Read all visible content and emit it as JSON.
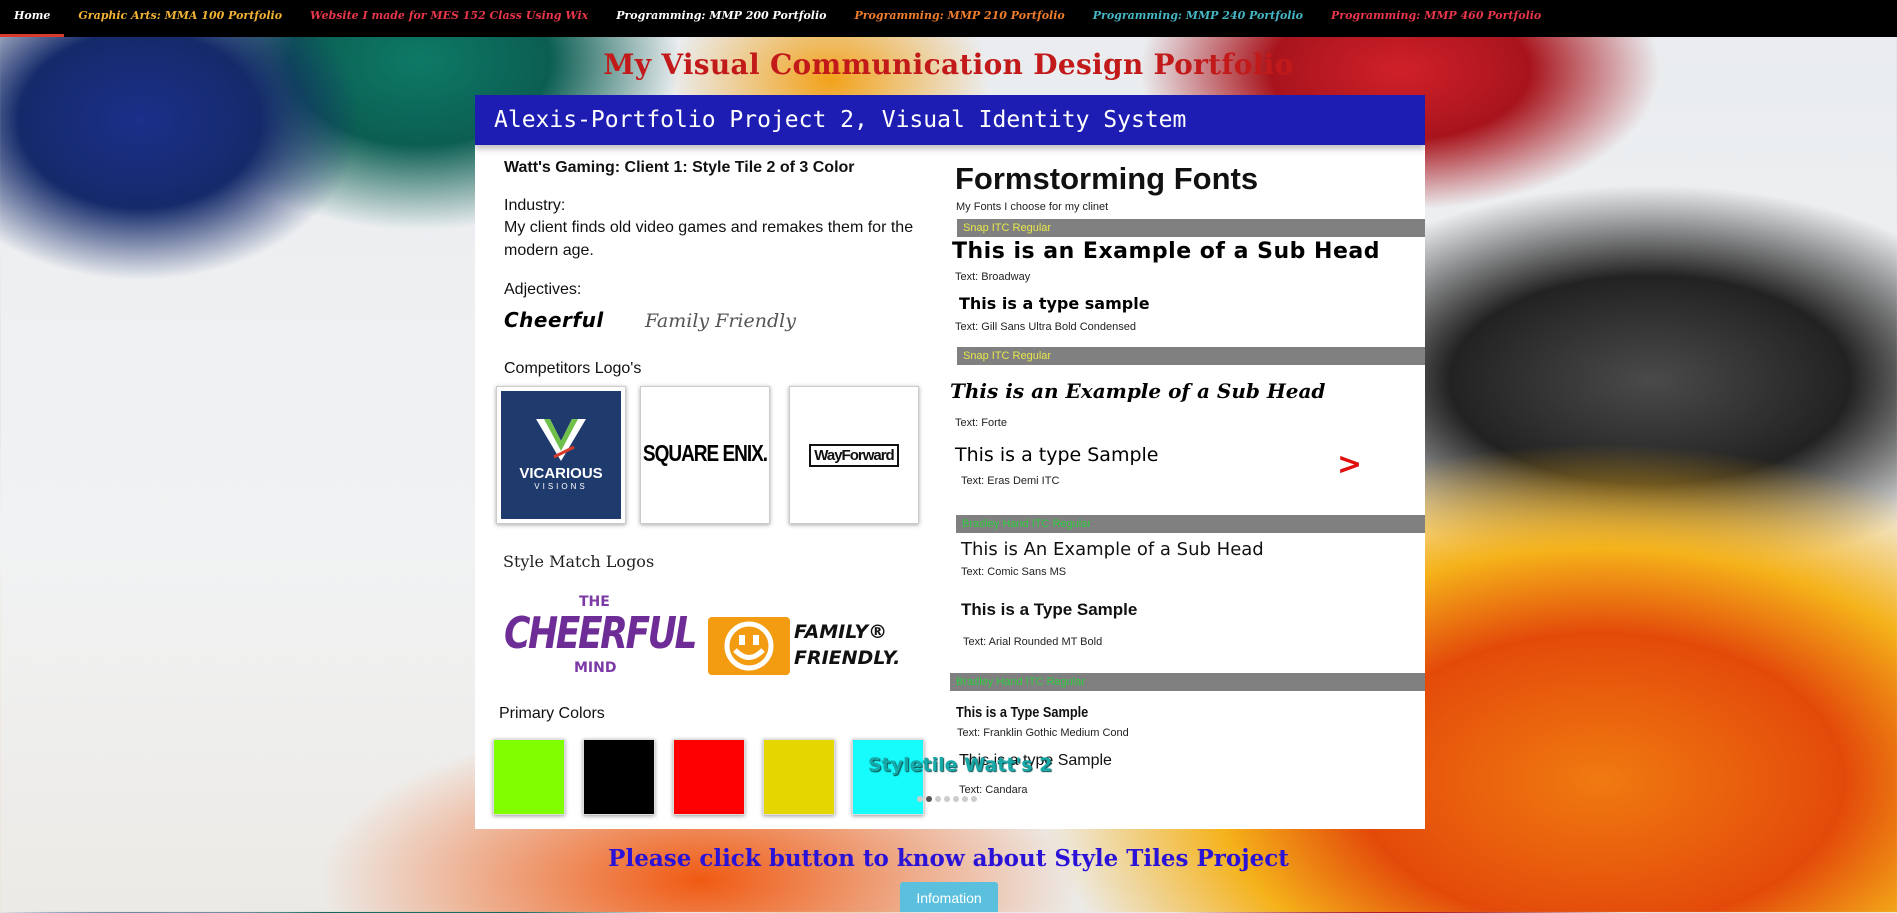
{
  "nav": {
    "items": [
      {
        "label": "Home",
        "color": "#ffffff"
      },
      {
        "label": "Graphic Arts: MMA 100 Portfolio",
        "color": "#f2b233"
      },
      {
        "label": "Website I made for MES 152 Class Using Wix",
        "color": "#e8364a"
      },
      {
        "label": "Programming: MMP 200 Portfolio",
        "color": "#ffffff"
      },
      {
        "label": "Programming: MMP 210 Portfolio",
        "color": "#ef7d2c"
      },
      {
        "label": "Programming: MMP 240 Portfolio",
        "color": "#45b7c4"
      },
      {
        "label": "Programming: MMP 460 Portfolio",
        "color": "#e8364a"
      }
    ],
    "active_index": 0
  },
  "site_title": "My Visual Communication Design Portfolio",
  "slider": {
    "header": "Alexis-Portfolio Project 2, Visual Identity System",
    "caption": "Styletile Watt's 2",
    "slide_count": 7,
    "active_slide": 1,
    "next_arrow": ">"
  },
  "styletile": {
    "heading": "Watt's Gaming: Client 1: Style Tile 2 of 3 Color",
    "industry_label": "Industry:",
    "industry_line1": "My client finds old video games and remakes them for the",
    "industry_line2": "modern age.",
    "adjectives_label": "Adjectives:",
    "adjective_1": "Cheerful",
    "adjective_2": "Family Friendly",
    "competitors_label": "Competitors Logo's",
    "competitors": [
      {
        "name": "VICARIOUS",
        "sub": "VISIONS"
      },
      {
        "name": "SQUARE ENIX."
      },
      {
        "name": "WayForward"
      }
    ],
    "style_match_label": "Style Match Logos",
    "cheerful_logo": {
      "top": "THE",
      "main": "CHEERFUL",
      "bottom": "MIND"
    },
    "family_logo": {
      "line1": "FAMILY®",
      "line2": "FRIENDLY."
    },
    "primary_colors_label": "Primary Colors",
    "primary_colors": [
      "#80ff00",
      "#000000",
      "#ff0000",
      "#e6d600",
      "#16fcfc"
    ]
  },
  "fonts": {
    "title": "Formstorming Fonts",
    "subtitle": "My Fonts I choose for my clinet",
    "bar1": "Snap ITC Regular",
    "subhead1": "This is an Example of a Sub Head",
    "subhead1_font": "Text: Broadway",
    "sample1": "This is a type sample",
    "sample1_font": "Text: Gill Sans Ultra Bold Condensed",
    "bar2": "Snap ITC Regular",
    "subhead2": "This is an Example of a Sub Head",
    "subhead2_font": "Text: Forte",
    "sample2": "This is a type Sample",
    "sample2_font": "Text: Eras Demi ITC",
    "bar3": "Bradley Hand ITC Regular",
    "subhead3": "This is An Example of a Sub Head",
    "subhead3_font": "Text: Comic Sans MS",
    "sample3": "This is a Type Sample",
    "sample3_font": "Text: Arial Rounded MT Bold",
    "bar4": "Bradley Hand ITC Regular",
    "sample4": "This is a Type Sample",
    "sample4_font": "Text: Franklin Gothic Medium Cond",
    "sample5": "This is a type Sample",
    "sample5_font": "Text: Candara"
  },
  "footer": {
    "note": "Please click button to know about Style Tiles Project",
    "button": "Infomation"
  }
}
